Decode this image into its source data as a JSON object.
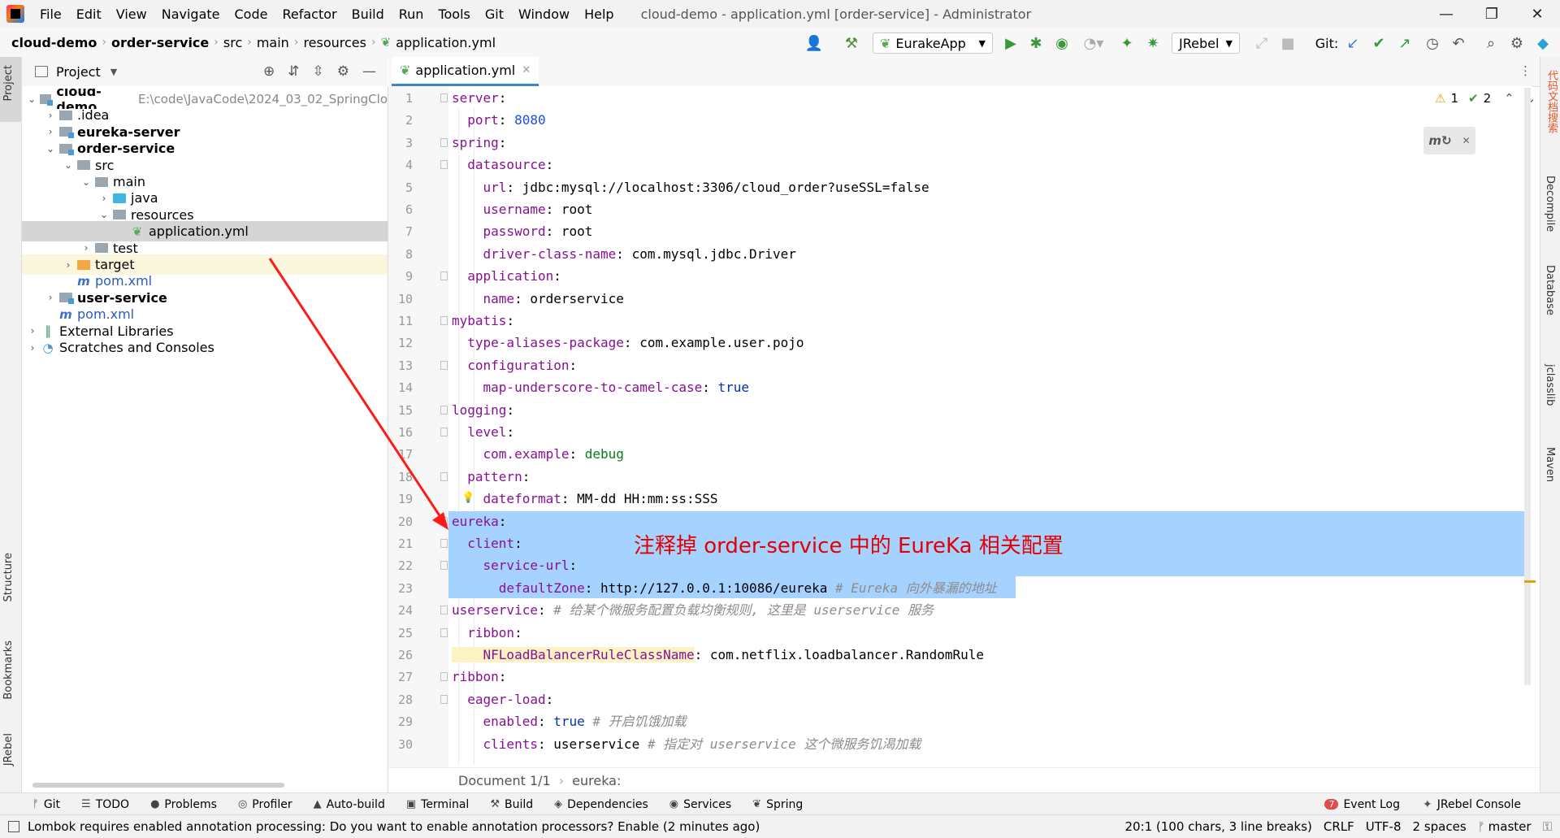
{
  "window": {
    "title": "cloud-demo - application.yml [order-service] - Administrator",
    "menu": [
      "File",
      "Edit",
      "View",
      "Navigate",
      "Code",
      "Refactor",
      "Build",
      "Run",
      "Tools",
      "Git",
      "Window",
      "Help"
    ]
  },
  "navbar": {
    "breadcrumbs": [
      "cloud-demo",
      "order-service",
      "src",
      "main",
      "resources",
      "application.yml"
    ],
    "run_config": "EurakeApp",
    "jrebel_config": "JRebel",
    "git_label": "Git:"
  },
  "project_panel": {
    "title": "Project",
    "tree": [
      {
        "label": "cloud-demo",
        "path": "E:\\code\\JavaCode\\2024_03_02_SpringClo",
        "bold": true,
        "expanded": true
      },
      {
        "label": ".idea",
        "expanded": false
      },
      {
        "label": "eureka-server",
        "bold": true,
        "expanded": false
      },
      {
        "label": "order-service",
        "bold": true,
        "expanded": true
      },
      {
        "label": "src",
        "expanded": true
      },
      {
        "label": "main",
        "expanded": true
      },
      {
        "label": "java",
        "expanded": false
      },
      {
        "label": "resources",
        "expanded": true
      },
      {
        "label": "application.yml",
        "selected": true
      },
      {
        "label": "test",
        "expanded": false
      },
      {
        "label": "target",
        "expanded": false
      },
      {
        "label": "pom.xml"
      },
      {
        "label": "user-service",
        "bold": true,
        "expanded": false
      },
      {
        "label": "pom.xml"
      },
      {
        "label": "External Libraries",
        "expanded": false
      },
      {
        "label": "Scratches and Consoles",
        "expanded": false
      }
    ]
  },
  "editor": {
    "tab_label": "application.yml",
    "warnings": "1",
    "checks": "2",
    "annotation": "注释掉 order-service 中的 EureKa 相关配置",
    "lines": [
      {
        "n": "1",
        "key": "server",
        "sep": ":",
        "val": "",
        "cm": ""
      },
      {
        "n": "2",
        "key": "  port",
        "sep": ": ",
        "val": "8080",
        "cm": ""
      },
      {
        "n": "3",
        "key": "spring",
        "sep": ":",
        "val": "",
        "cm": ""
      },
      {
        "n": "4",
        "key": "  datasource",
        "sep": ":",
        "val": "",
        "cm": ""
      },
      {
        "n": "5",
        "key": "    url",
        "sep": ": ",
        "val": "jdbc:mysql://localhost:3306/cloud_order?useSSL=false",
        "cm": ""
      },
      {
        "n": "6",
        "key": "    username",
        "sep": ": ",
        "val": "root",
        "cm": ""
      },
      {
        "n": "7",
        "key": "    password",
        "sep": ": ",
        "val": "root",
        "cm": ""
      },
      {
        "n": "8",
        "key": "    driver-class-name",
        "sep": ": ",
        "val": "com.mysql.jdbc.Driver",
        "cm": ""
      },
      {
        "n": "9",
        "key": "  application",
        "sep": ":",
        "val": "",
        "cm": ""
      },
      {
        "n": "10",
        "key": "    name",
        "sep": ": ",
        "val": "orderservice",
        "cm": ""
      },
      {
        "n": "11",
        "key": "mybatis",
        "sep": ":",
        "val": "",
        "cm": ""
      },
      {
        "n": "12",
        "key": "  type-aliases-package",
        "sep": ": ",
        "val": "com.example.user.pojo",
        "cm": ""
      },
      {
        "n": "13",
        "key": "  configuration",
        "sep": ":",
        "val": "",
        "cm": ""
      },
      {
        "n": "14",
        "key": "    map-underscore-to-camel-case",
        "sep": ": ",
        "val": "true",
        "cm": ""
      },
      {
        "n": "15",
        "key": "logging",
        "sep": ":",
        "val": "",
        "cm": ""
      },
      {
        "n": "16",
        "key": "  level",
        "sep": ":",
        "val": "",
        "cm": ""
      },
      {
        "n": "17",
        "key": "    com.example",
        "sep": ": ",
        "val": "debug",
        "cm": ""
      },
      {
        "n": "18",
        "key": "  pattern",
        "sep": ":",
        "val": "",
        "cm": ""
      },
      {
        "n": "19",
        "key": "    dateformat",
        "sep": ": ",
        "val": "MM-dd HH:mm:ss:SSS",
        "cm": ""
      },
      {
        "n": "20",
        "key": "eureka",
        "sep": ":",
        "val": "",
        "cm": ""
      },
      {
        "n": "21",
        "key": "  client",
        "sep": ":",
        "val": "",
        "cm": ""
      },
      {
        "n": "22",
        "key": "    service-url",
        "sep": ":",
        "val": "",
        "cm": ""
      },
      {
        "n": "23",
        "key": "      defaultZone",
        "sep": ": ",
        "val": "http://127.0.0.1:10086/eureka",
        "cm": " # Eureka 向外暴漏的地址"
      },
      {
        "n": "24",
        "key": "userservice",
        "sep": ":",
        "val": "",
        "cm": " # 给某个微服务配置负载均衡规则, 这里是 userservice 服务"
      },
      {
        "n": "25",
        "key": "  ribbon",
        "sep": ":",
        "val": "",
        "cm": ""
      },
      {
        "n": "26",
        "key": "    NFLoadBalancerRuleClassName",
        "sep": ": ",
        "val": "com.netflix.loadbalancer.RandomRule",
        "cm": ""
      },
      {
        "n": "27",
        "key": "ribbon",
        "sep": ":",
        "val": "",
        "cm": ""
      },
      {
        "n": "28",
        "key": "  eager-load",
        "sep": ":",
        "val": "",
        "cm": ""
      },
      {
        "n": "29",
        "key": "    enabled",
        "sep": ": ",
        "val": "true",
        "cm": " # 开启饥饿加载"
      },
      {
        "n": "30",
        "key": "    clients",
        "sep": ": ",
        "val": "userservice",
        "cm": " # 指定对 userservice 这个微服务饥渴加载"
      }
    ],
    "breadcrumb": [
      "Document 1/1",
      "eureka:"
    ]
  },
  "left_stripe": [
    "Project",
    "Structure",
    "Bookmarks",
    "JRebel"
  ],
  "right_stripe": [
    "代码文档搜索",
    "Decompile",
    "Database",
    "jclasslib",
    "Maven"
  ],
  "bottom_toolbar": {
    "left": [
      "Git",
      "TODO",
      "Problems",
      "Profiler",
      "Auto-build",
      "Terminal",
      "Build",
      "Dependencies",
      "Services",
      "Spring"
    ],
    "event_log": "Event Log",
    "event_count": "7",
    "jrebel_console": "JRebel Console"
  },
  "statusbar": {
    "message": "Lombok requires enabled annotation processing: Do you want to enable annotation processors? Enable (2 minutes ago)",
    "position": "20:1 (100 chars, 3 line breaks)",
    "line_sep": "CRLF",
    "encoding": "UTF-8",
    "indent": "2 spaces",
    "branch": "master"
  },
  "colors": {
    "selection": "#a6d2ff",
    "annotation": "#e30000",
    "accent": "#4083c9"
  }
}
